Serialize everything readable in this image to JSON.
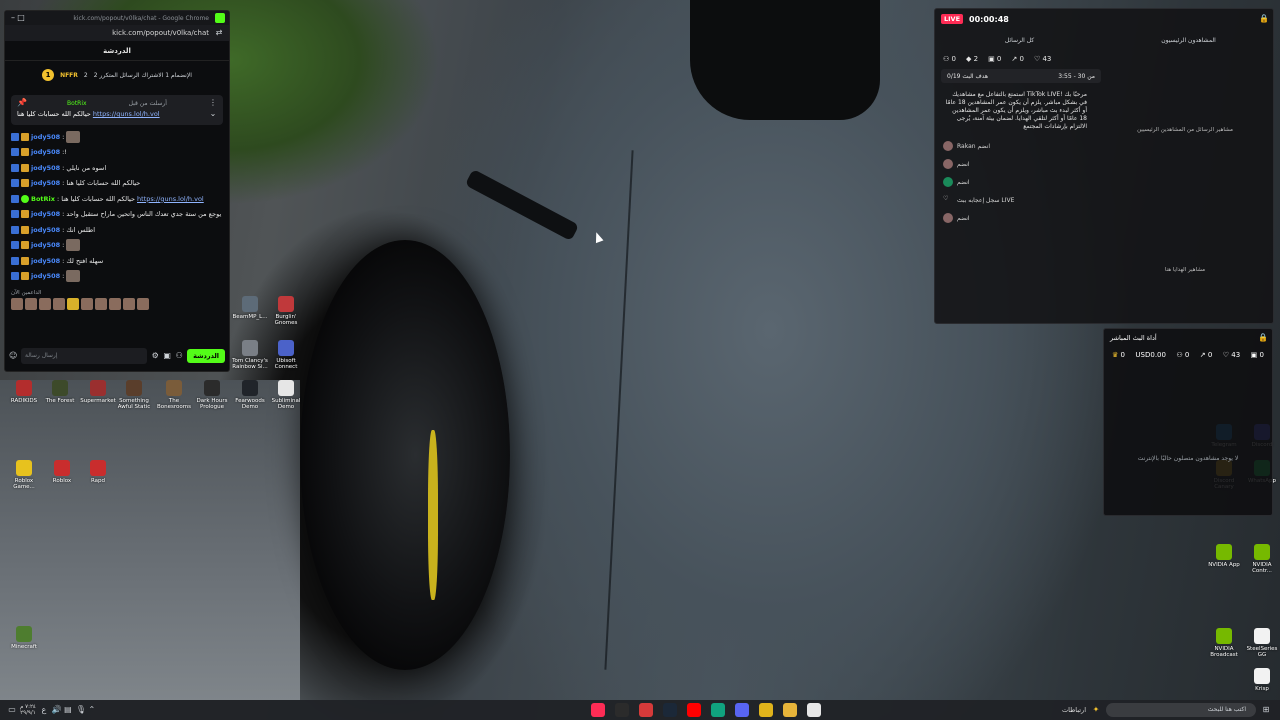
{
  "chat_window": {
    "title": "kick.com/popout/v0lka/chat - Google Chrome",
    "url": "kick.com/popout/v0lka/chat",
    "header": "الدردشة",
    "goal": {
      "coin": "1",
      "name": "NFFR",
      "count": "2",
      "text": "2 الإنضمام 1 الاشتراك الرسائل المتكرر"
    },
    "pinned": {
      "time": "أرسلت من قبل",
      "user": "BotRix",
      "text": "حيالكم الله حسابات كليا هنا",
      "link": "https://guns.lol/h.vol"
    },
    "messages": [
      {
        "user": "jody508",
        "text": ":",
        "emote": true
      },
      {
        "user": "jody508",
        "text": ":!",
        "emote": false
      },
      {
        "user": "jody508",
        "text": ": اسوه من نايلي",
        "emote": false
      },
      {
        "user": "jody508",
        "text": ": حيالكم الله حسابات كليا هنا",
        "emote": false
      },
      {
        "user": "BotRix",
        "text": ": حيالكم الله حسابات كليا هنا",
        "link": "https://guns.lol/h.vol",
        "bot": true
      },
      {
        "user": "jody508",
        "text": ": يوجع من ستة جدي تعدك الناس واتحين ماراح ستقبل واحد",
        "emote": false
      },
      {
        "user": "jody508",
        "text": ": اطلس انك",
        "emote": false
      },
      {
        "user": "jody508",
        "text": ":",
        "emote": true
      },
      {
        "user": "jody508",
        "text": ": سهله افتح لك",
        "emote": false
      },
      {
        "user": "jody508",
        "text": ":",
        "emote": true
      }
    ],
    "recent_label": "الداعمين الآن",
    "input_placeholder": "إرسال رسالة",
    "send_label": "الدردشة"
  },
  "desktop_icons": [
    {
      "label": "BeamMP_L...",
      "color": "#5d6b78"
    },
    {
      "label": "Burglin' Gnomes",
      "color": "#c0393b"
    },
    {
      "label": "Tom Clancy's Rainbow Si...",
      "color": "#7a7f86"
    },
    {
      "label": "Ubisoft Connect",
      "color": "#4b62c9"
    },
    {
      "label": "RADIKIDS",
      "color": "#b32d2d"
    },
    {
      "label": "The Forest",
      "color": "#3d4a2a"
    },
    {
      "label": "Supermarket",
      "color": "#9a2f2f"
    },
    {
      "label": "Something Awful Static",
      "color": "#5a3e2b"
    },
    {
      "label": "The Bonesrooms",
      "color": "#7a5c3a"
    },
    {
      "label": "Dark Hours Prologue",
      "color": "#2b2b2b"
    },
    {
      "label": "Fearwoods Demo",
      "color": "#20242a"
    },
    {
      "label": "Subliminal Demo",
      "color": "#e6e6e6"
    },
    {
      "label": "Roblox Game...",
      "color": "#e7c21e"
    },
    {
      "label": "Roblox",
      "color": "#c92d2d"
    },
    {
      "label": "Rapd",
      "color": "#c92d2d"
    },
    {
      "label": "Minecraft",
      "color": "#4e7d2f"
    },
    {
      "label": "Telegram",
      "color": "#2c8fd1"
    },
    {
      "label": "Discord",
      "color": "#5865f2"
    },
    {
      "label": "Discord Canary",
      "color": "#e4b72a"
    },
    {
      "label": "WhatsApp",
      "color": "#25d366"
    },
    {
      "label": "NVIDIA App",
      "color": "#76b900"
    },
    {
      "label": "NVIDIA Contr...",
      "color": "#76b900"
    },
    {
      "label": "NVIDIA Broadcast",
      "color": "#76b900"
    },
    {
      "label": "SteelSeries GG",
      "color": "#f2f2f2"
    },
    {
      "label": "Krisp",
      "color": "#f2f2f2"
    }
  ],
  "live_panel": {
    "live_label": "LIVE",
    "timer": "00:00:48",
    "tab_all": "كل الرسائل",
    "tab_top": "المشاهدون الرئيسيون",
    "stats": [
      "0",
      "2",
      "0",
      "0",
      "43"
    ],
    "goal_text": "0/19 هدف البث",
    "goal_time": "3:55 - 30 من",
    "welcome": "استمتع بالتفاعل مع مشاهديك TikTok LIVE! مرحبًا بك في بشكل مباشر. يلزم أن يكون عمر المشاهدين 18 عامًا أو أكثر لبدء بث مباشر، ويلزم أن يكون عمر المشاهدين 18 عامًا أو أكثر لتلقي الهدايا. لضمان بيئة آمنة، يُرجى الالتزام بإرشادات المجتمع",
    "rows": [
      "Rakan انضم",
      "انضم",
      "انضم",
      "سجل إعجابه ببث LIVE",
      "انضم"
    ],
    "gifts_label": "مشاهير الهدايا هنا",
    "top_viewers_label": "مشاهير الرسائل من المشاهدين الرئيسيين"
  },
  "tool_panel": {
    "title": "أداة البث المباشر",
    "currency": "USD0.00",
    "stats": [
      "0",
      "0",
      "0",
      "43",
      "0"
    ],
    "empty_text": "لا يوجد مشاهدون متصلون حاليًا بالإنترنت"
  },
  "taskbar": {
    "search_placeholder": "اكتب هنا للبحث",
    "time": "٧:٢٤ م",
    "date": "٢٩/٩/١",
    "news_label": "ارتباطات",
    "apps": [
      {
        "name": "tiktok-live-icon",
        "color": "#fe2c55"
      },
      {
        "name": "chatgpt-icon",
        "color": "#2b2b2b"
      },
      {
        "name": "adobe-icon",
        "color": "#d63a3a"
      },
      {
        "name": "steam-icon",
        "color": "#1b2838"
      },
      {
        "name": "youtube-icon",
        "color": "#ff0000"
      },
      {
        "name": "app-icon",
        "color": "#10a37f"
      },
      {
        "name": "discord-icon",
        "color": "#5865f2"
      },
      {
        "name": "chrome-icon",
        "color": "#e0b31b"
      },
      {
        "name": "explorer-icon",
        "color": "#e8b53a"
      },
      {
        "name": "calendar-icon",
        "color": "#e7e7e7"
      }
    ]
  }
}
